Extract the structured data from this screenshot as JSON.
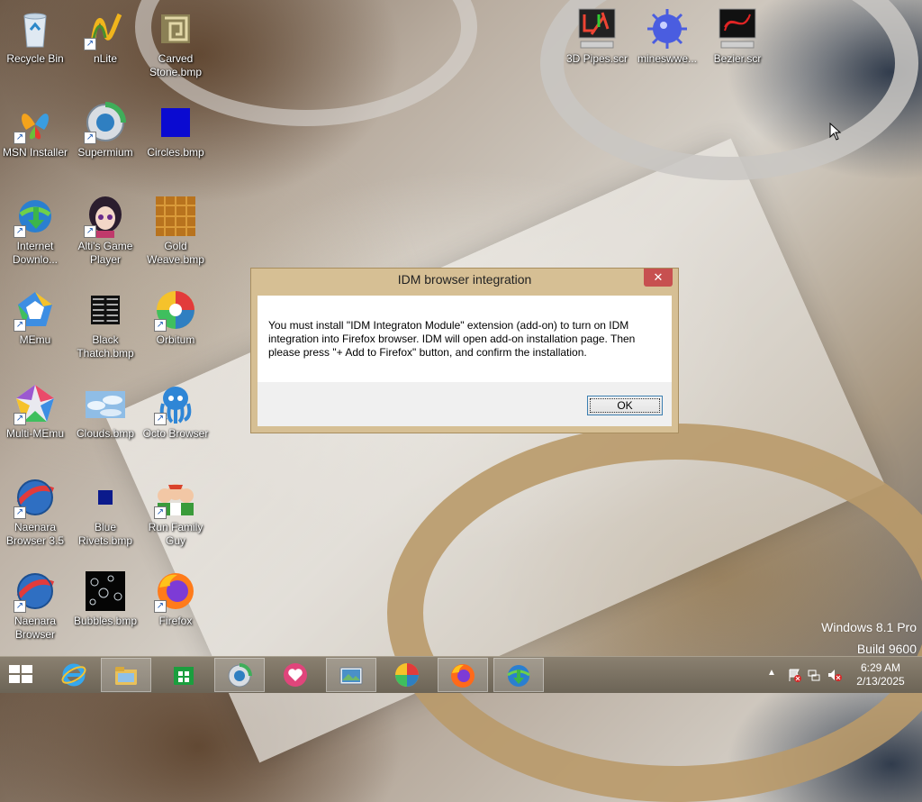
{
  "desktop_icons": [
    {
      "label": "Recycle Bin",
      "icon": "recycle-bin-icon",
      "shortcut": false
    },
    {
      "label": "nLite",
      "icon": "nlite-icon",
      "shortcut": true
    },
    {
      "label": "Carved Stone.bmp",
      "icon": "bmp-image-icon",
      "shortcut": false
    },
    {
      "label": "MSN Installer",
      "icon": "msn-butterfly-icon",
      "shortcut": true
    },
    {
      "label": "Supermium",
      "icon": "supermium-browser-icon",
      "shortcut": true
    },
    {
      "label": "Circles.bmp",
      "icon": "bmp-image-icon",
      "shortcut": false
    },
    {
      "label": "Internet Downlo...",
      "icon": "idm-icon",
      "shortcut": true
    },
    {
      "label": "Alti's Game Player",
      "icon": "game-player-icon",
      "shortcut": true
    },
    {
      "label": "Gold Weave.bmp",
      "icon": "bmp-image-icon",
      "shortcut": false
    },
    {
      "label": "MEmu",
      "icon": "memu-icon",
      "shortcut": true
    },
    {
      "label": "Black Thatch.bmp",
      "icon": "bmp-image-icon",
      "shortcut": false
    },
    {
      "label": "Orbitum",
      "icon": "orbitum-icon",
      "shortcut": true
    },
    {
      "label": "Multi-MEmu",
      "icon": "multi-memu-icon",
      "shortcut": true
    },
    {
      "label": "Clouds.bmp",
      "icon": "bmp-image-icon",
      "shortcut": false
    },
    {
      "label": "Octo Browser",
      "icon": "octo-browser-icon",
      "shortcut": true
    },
    {
      "label": "Naenara Browser 3.5",
      "icon": "naenara-icon",
      "shortcut": true
    },
    {
      "label": "Blue Rivets.bmp",
      "icon": "bmp-image-icon",
      "shortcut": false
    },
    {
      "label": "Run Family Guy",
      "icon": "family-guy-icon",
      "shortcut": true
    },
    {
      "label": "Naenara Browser",
      "icon": "naenara-icon",
      "shortcut": true
    },
    {
      "label": "Bubbles.bmp",
      "icon": "bmp-image-icon",
      "shortcut": false
    },
    {
      "label": "Firefox",
      "icon": "firefox-icon",
      "shortcut": true
    },
    {
      "label": "3D Pipes.scr",
      "icon": "screensaver-icon",
      "shortcut": false
    },
    {
      "label": "mineswwe...",
      "icon": "mine-icon",
      "shortcut": false
    },
    {
      "label": "Bezier.scr",
      "icon": "screensaver-icon",
      "shortcut": false
    }
  ],
  "dialog": {
    "title": "IDM browser integration",
    "close_label": "✕",
    "message": "You must install \"IDM Integraton Module\" extension (add-on) to turn on IDM integration into Firefox browser. IDM will open add-on installation page. Then please press \"+ Add to Firefox\" button, and confirm the installation.",
    "ok_label": "OK"
  },
  "watermark": {
    "line1": "Windows 8.1 Pro",
    "line2": "Build 9600"
  },
  "taskbar": {
    "buttons": [
      {
        "name": "internet-explorer",
        "icon": "ie-icon",
        "color": "#1e90ff"
      },
      {
        "name": "file-explorer",
        "icon": "folder-icon",
        "color": "#e8c05a"
      },
      {
        "name": "store",
        "icon": "store-icon",
        "color": "#1b9e3e"
      },
      {
        "name": "supermium",
        "icon": "supermium-browser-icon",
        "color": "#2f7fc1"
      },
      {
        "name": "heart-app",
        "icon": "heart-icon",
        "color": "#e0457b"
      },
      {
        "name": "image-viewer",
        "icon": "image-viewer-icon",
        "color": "#4a90c8"
      },
      {
        "name": "orbitum",
        "icon": "orbitum-icon",
        "color": "#e84b2a"
      },
      {
        "name": "firefox",
        "icon": "firefox-icon",
        "color": "#ff6a1a"
      },
      {
        "name": "idm",
        "icon": "idm-icon",
        "color": "#2aa04a"
      }
    ],
    "clock_time": "6:29 AM",
    "clock_date": "2/13/2025"
  }
}
